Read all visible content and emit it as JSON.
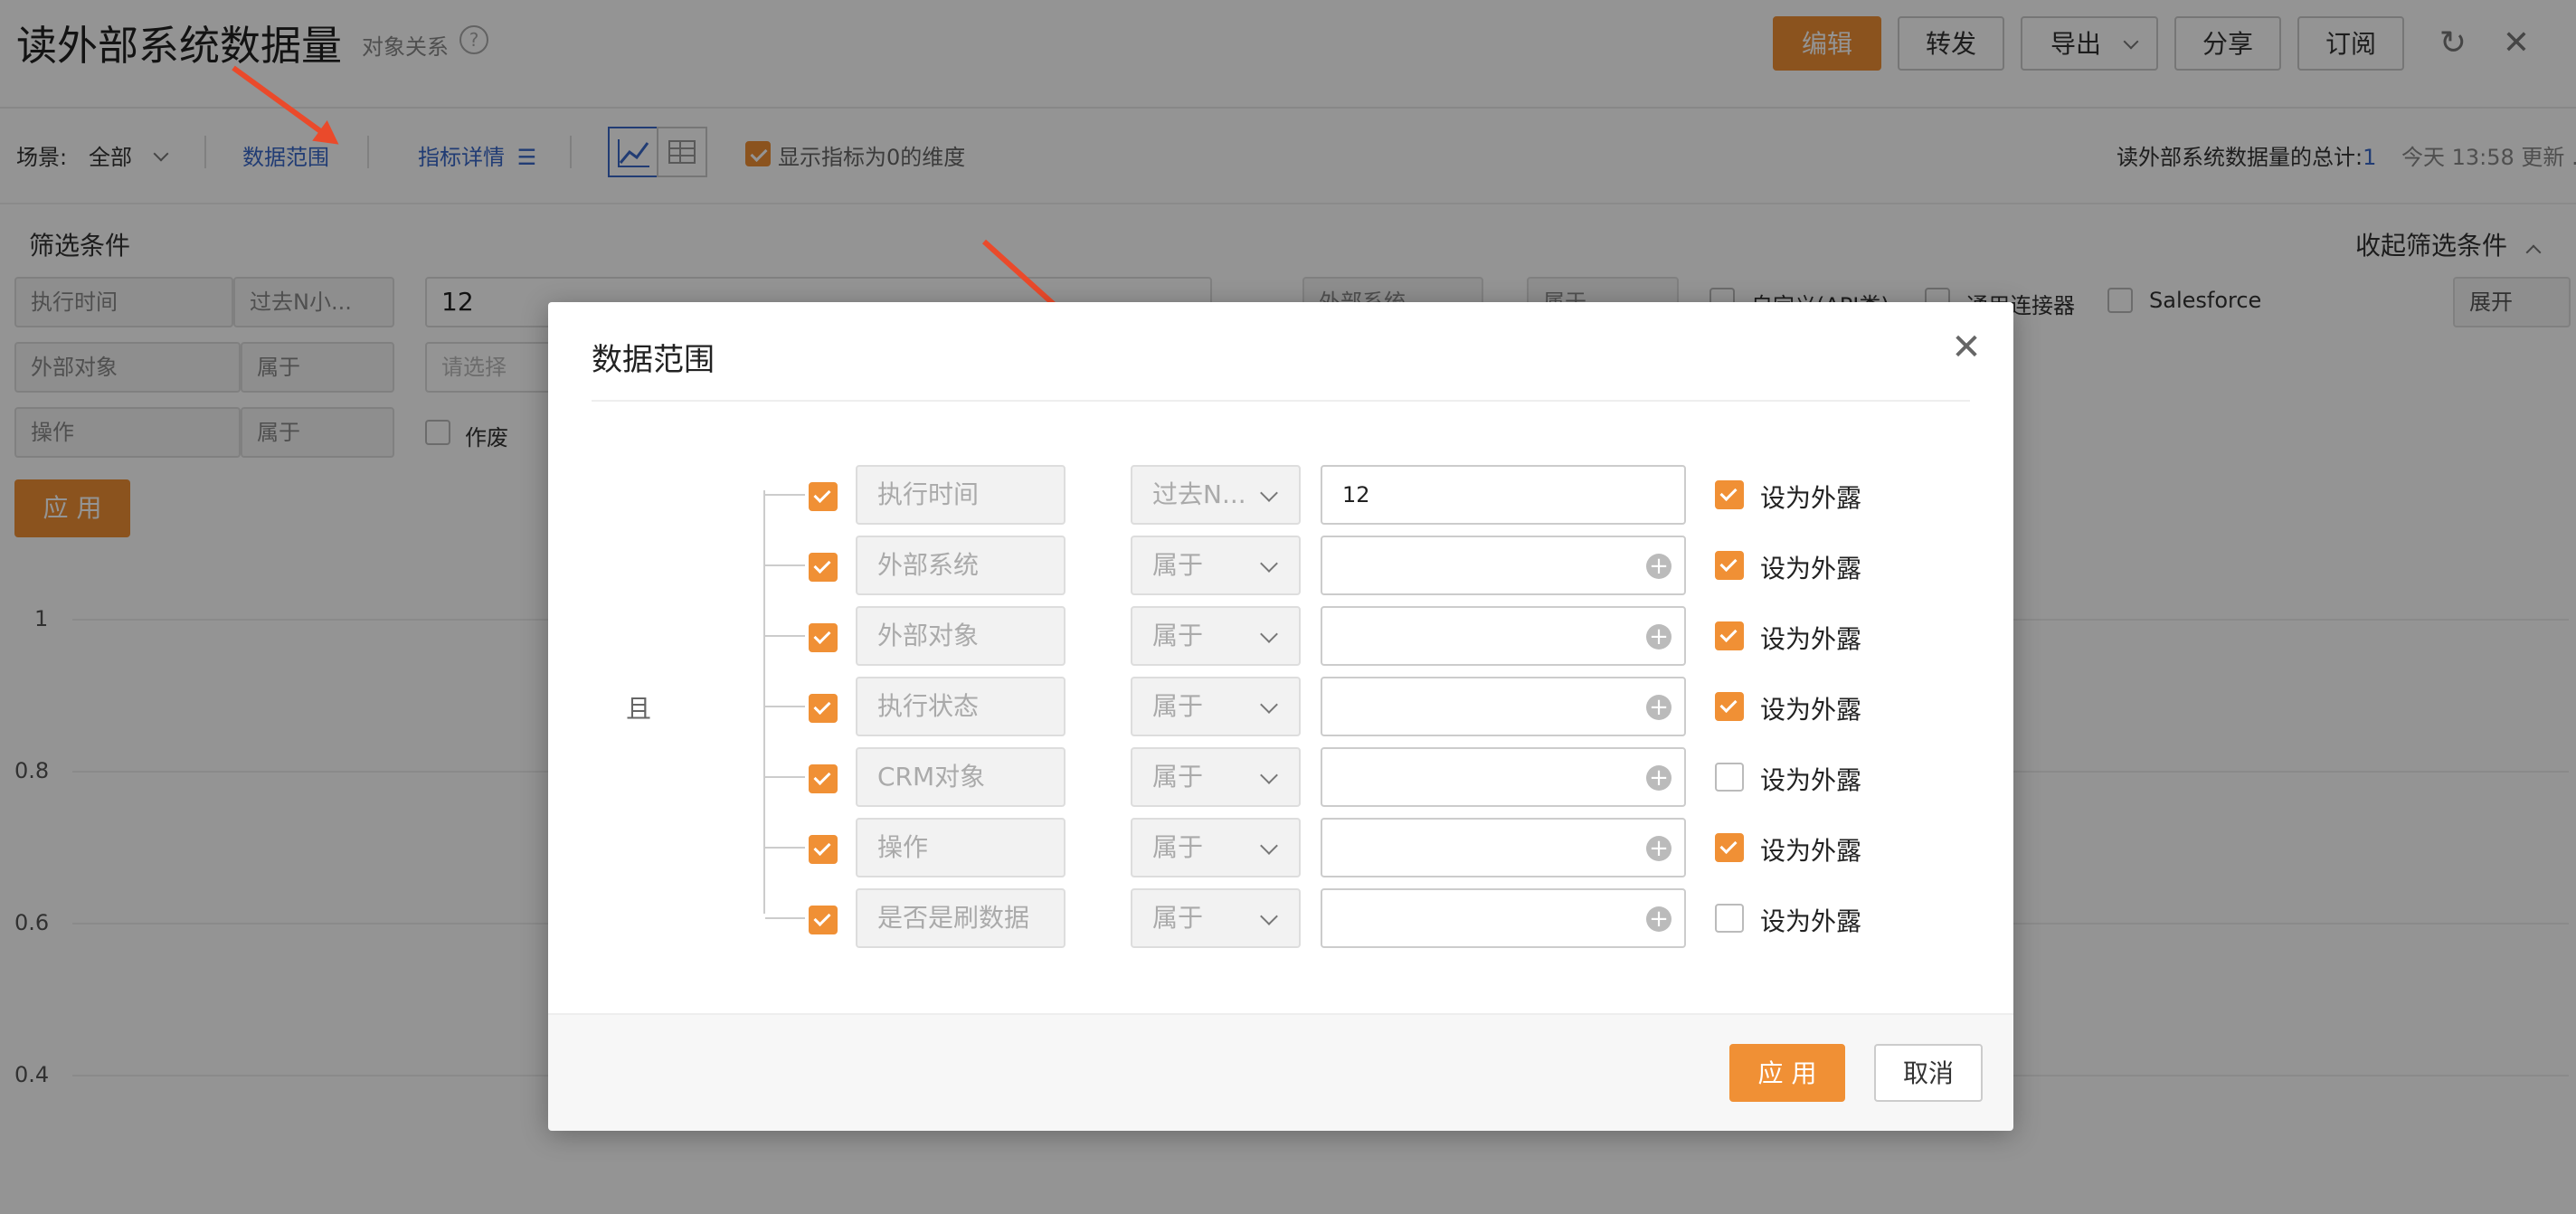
{
  "header": {
    "title": "读外部系统数据量",
    "object_relation": "对象关系",
    "help": "?",
    "buttons": {
      "edit": "编辑",
      "forward": "转发",
      "export": "导出",
      "share": "分享",
      "subscribe": "订阅"
    },
    "refresh_icon": "refresh-icon",
    "close_icon": "close-icon"
  },
  "toolbar": {
    "scene_label": "场景:",
    "scene_value": "全部",
    "data_range": "数据范围",
    "metric_detail": "指标详情",
    "show_zero_label": "显示指标为0的维度",
    "total_label": "读外部系统数据量的总计:",
    "total_value": "1",
    "updated": "今天 13:58 更新 ."
  },
  "filters": {
    "title": "筛选条件",
    "collapse": "收起筛选条件",
    "expand": "展开",
    "rows": [
      {
        "field": "执行时间",
        "op": "过去N小...",
        "value": "12"
      },
      {
        "field": "外部对象",
        "op": "属于",
        "value": "",
        "placeholder": "请选择"
      },
      {
        "field": "操作",
        "op": "属于",
        "option": "作废"
      }
    ],
    "side": {
      "field": "外部系统",
      "op": "属于"
    },
    "options": [
      "自定义(API类)",
      "通用连接器",
      "Salesforce"
    ],
    "apply": "应 用"
  },
  "chart_axis": {
    "ticks": [
      "1",
      "0.8",
      "0.6",
      "0.4"
    ]
  },
  "modal": {
    "title": "数据范围",
    "and_label": "且",
    "expose_label": "设为外露",
    "apply": "应 用",
    "cancel": "取消",
    "rows": [
      {
        "field": "执行时间",
        "op": "过去N...",
        "value": "12",
        "checked": true,
        "expose": true
      },
      {
        "field": "外部系统",
        "op": "属于",
        "value": "",
        "checked": true,
        "expose": true
      },
      {
        "field": "外部对象",
        "op": "属于",
        "value": "",
        "checked": true,
        "expose": true
      },
      {
        "field": "执行状态",
        "op": "属于",
        "value": "",
        "checked": true,
        "expose": true
      },
      {
        "field": "CRM对象",
        "op": "属于",
        "value": "",
        "checked": true,
        "expose": false
      },
      {
        "field": "操作",
        "op": "属于",
        "value": "",
        "checked": true,
        "expose": true
      },
      {
        "field": "是否是刷数据",
        "op": "属于",
        "value": "",
        "checked": true,
        "expose": false
      }
    ]
  },
  "colors": {
    "accent": "#f09035",
    "link": "#3a68c8",
    "arrow": "#ea4a2b"
  }
}
